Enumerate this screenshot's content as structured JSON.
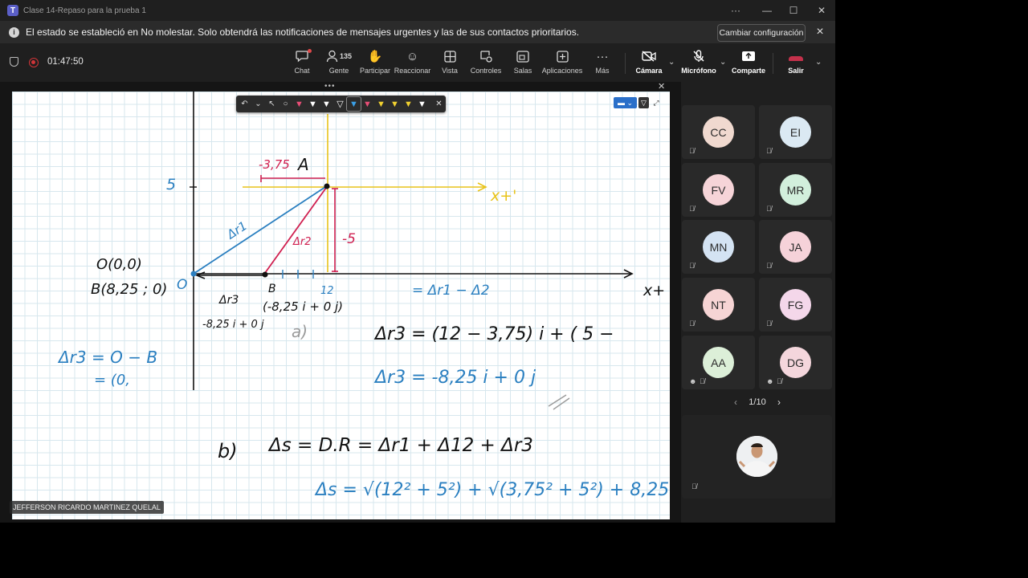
{
  "window": {
    "title": "Clase 14-Repaso para la prueba 1",
    "controls": {
      "more": "···",
      "minimize": "—",
      "maximize": "☐",
      "close": "✕"
    }
  },
  "banner": {
    "message": "El estado se estableció en No molestar. Solo obtendrá las notificaciones de mensajes urgentes y las de sus contactos prioritarios.",
    "button": "Cambiar configuración"
  },
  "meeting": {
    "elapsed": "01:47:50",
    "toolbar": {
      "chat": "Chat",
      "people": "Gente",
      "people_count": "135",
      "raise_hand": "Participar",
      "react": "Reaccionar",
      "view": "Vista",
      "controls": "Controles",
      "rooms": "Salas",
      "apps": "Aplicaciones",
      "more": "Más",
      "camera": "Cámara",
      "mic": "Micrófono",
      "share": "Comparte",
      "leave": "Salir"
    }
  },
  "whiteboard": {
    "handwriting": {
      "origin_label": "O(0,0)",
      "b_coords": "B(8,25 ; 0)",
      "origin_zero": "O",
      "y_tick": "5",
      "a_offset": "-3,75",
      "point_a": "A",
      "x_prime": "x+'",
      "dr1": "Δr1",
      "dr2": "Δr2",
      "minus5": "-5",
      "point_b": "B",
      "x12": "12",
      "x_axis": "x+",
      "eq1": "= Δr1 − Δ2",
      "dr3": "Δr3",
      "b_vec": "(-8,25 i + 0 j)",
      "b_vec2": "-8,25 i + 0 j",
      "part_a": "a)",
      "dr3_eq": "Δr3 = O − B",
      "dr3_eq2": "= (0,",
      "calc1": "Δr3 = (12 − 3,75) i + ( 5 −",
      "calc2": "Δr3 = -8,25 i + 0 j",
      "part_b": "b)",
      "ds_eq": "Δs = D.R = Δr1 + Δ12 + Δr3",
      "ds_calc": "Δs = √(12² + 5²) + √(3,75² + 5²) + 8,25"
    },
    "presenter_name": "JEFFERSON RICARDO MARTINEZ QUELAL"
  },
  "gallery": {
    "participants": [
      {
        "initials": "CC",
        "color": "#f0d9cf"
      },
      {
        "initials": "EI",
        "color": "#dbe9f3"
      },
      {
        "initials": "FV",
        "color": "#f6d4d8"
      },
      {
        "initials": "MR",
        "color": "#d2efdc"
      },
      {
        "initials": "MN",
        "color": "#d4e3f3"
      },
      {
        "initials": "JA",
        "color": "#f6d2d9"
      },
      {
        "initials": "NT",
        "color": "#f6d4d4"
      },
      {
        "initials": "FG",
        "color": "#f4d7ea"
      },
      {
        "initials": "AA",
        "color": "#dcefd8"
      },
      {
        "initials": "DG",
        "color": "#f4d6dc"
      }
    ],
    "page": "1/10"
  }
}
